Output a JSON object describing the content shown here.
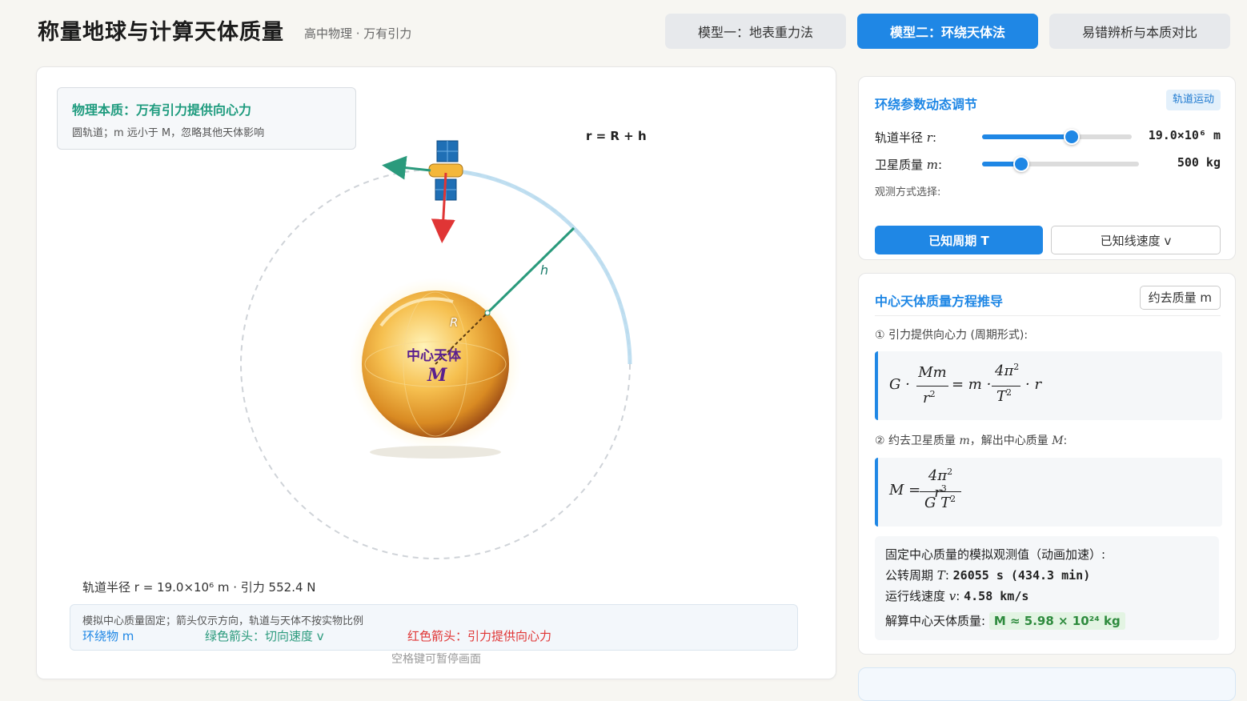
{
  "header": {
    "title": "称量地球与计算天体质量",
    "subtitle": "高中物理 · 万有引力",
    "tabs": [
      {
        "label": "模型一：地表重力法"
      },
      {
        "label": "模型二：环绕天体法"
      },
      {
        "label": "易错辨析与本质对比"
      }
    ]
  },
  "scene": {
    "essence_title": "物理本质：万有引力提供向心力",
    "essence_note": "圆轨道；m 远小于 M，忽略其他天体影响",
    "r_label": "r = R + h",
    "h_label": "h",
    "R_label": "R",
    "body_label": "中心天体",
    "body_symbol": "M",
    "status": "轨道半径 r = 19.0×10⁶ m · 引力 552.4 N",
    "legend_note": "模拟中心质量固定；箭头仅示方向，轨道与天体不按实物比例",
    "legend": {
      "satellite": "环绕物 m",
      "green": "绿色箭头：切向速度 v",
      "red": "红色箭头：引力提供向心力"
    },
    "pause_hint": "空格键可暂停画面",
    "colors": {
      "green": "#2a9a7c",
      "red": "#e03535",
      "blue": "#1f87e5"
    }
  },
  "params": {
    "title": "环绕参数动态调节",
    "badge": "轨道运动",
    "radius_label": "轨道半径",
    "radius_sym": "r",
    "radius_value": "19.0×10⁶ m",
    "radius_fraction": 0.6,
    "mass_label": "卫星质量",
    "mass_sym": "m",
    "mass_value": "500 kg",
    "mass_fraction": 0.25,
    "obs_label": "观测方式选择:",
    "obs_period": "已知周期 T",
    "obs_velocity": "已知线速度 v"
  },
  "derivation": {
    "title": "中心天体质量方程推导",
    "cancel_button": "约去质量 m",
    "step1": "① 引力提供向心力 (周期形式):",
    "step2_pre": "② 约去卫星质量",
    "step2_m": "m",
    "step2_mid": "，解出中心质量",
    "step2_M": "M",
    "step2_post": ":",
    "result_title": "固定中心质量的模拟观测值（动画加速）:",
    "period_label": "公转周期",
    "period_sym": "T",
    "period_value": "26055 s (434.3 min)",
    "velocity_label": "运行线速度",
    "velocity_sym": "v",
    "velocity_value": "4.58 km/s",
    "mass_label": "解算中心天体质量:",
    "mass_value": "M ≈ 5.98 × 10²⁴ kg"
  }
}
